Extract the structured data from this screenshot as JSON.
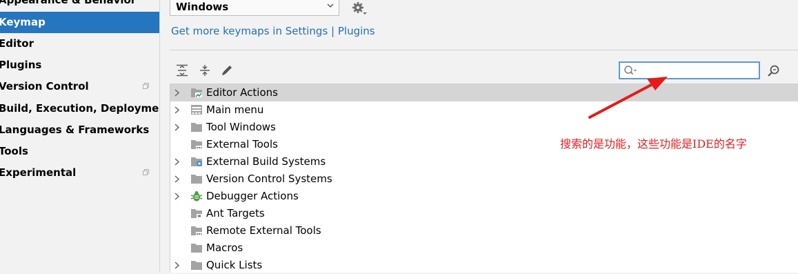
{
  "sidebar": {
    "items": [
      {
        "label": "Appearance & Behavior",
        "selected": false,
        "has_copy_icon": false
      },
      {
        "label": "Keymap",
        "selected": true,
        "has_copy_icon": false
      },
      {
        "label": "Editor",
        "selected": false,
        "has_copy_icon": false
      },
      {
        "label": "Plugins",
        "selected": false,
        "has_copy_icon": false
      },
      {
        "label": "Version Control",
        "selected": false,
        "has_copy_icon": true
      },
      {
        "label": "Build, Execution, Deployment",
        "selected": false,
        "has_copy_icon": false
      },
      {
        "label": "Languages & Frameworks",
        "selected": false,
        "has_copy_icon": false
      },
      {
        "label": "Tools",
        "selected": false,
        "has_copy_icon": false
      },
      {
        "label": "Experimental",
        "selected": false,
        "has_copy_icon": true
      }
    ]
  },
  "keymap": {
    "selected_value": "Windows",
    "link_text_1": "Get more keymaps in Settings",
    "link_separator": " | ",
    "link_text_2": "Plugins"
  },
  "search": {
    "value": "",
    "placeholder": ""
  },
  "tree": {
    "rows": [
      {
        "label": "Editor Actions",
        "expandable": true,
        "selected": true,
        "icon": "editor-actions-folder-icon"
      },
      {
        "label": "Main menu",
        "expandable": true,
        "selected": false,
        "icon": "main-menu-icon"
      },
      {
        "label": "Tool Windows",
        "expandable": true,
        "selected": false,
        "icon": "folder-icon"
      },
      {
        "label": "External Tools",
        "expandable": false,
        "selected": false,
        "icon": "folder-tools-icon"
      },
      {
        "label": "External Build Systems",
        "expandable": true,
        "selected": false,
        "icon": "folder-gear-icon"
      },
      {
        "label": "Version Control Systems",
        "expandable": true,
        "selected": false,
        "icon": "folder-icon"
      },
      {
        "label": "Debugger Actions",
        "expandable": true,
        "selected": false,
        "icon": "bug-icon"
      },
      {
        "label": "Ant Targets",
        "expandable": false,
        "selected": false,
        "icon": "folder-ant-icon"
      },
      {
        "label": "Remote External Tools",
        "expandable": false,
        "selected": false,
        "icon": "folder-tools-icon"
      },
      {
        "label": "Macros",
        "expandable": false,
        "selected": false,
        "icon": "folder-icon"
      },
      {
        "label": "Quick Lists",
        "expandable": true,
        "selected": false,
        "icon": "folder-icon"
      }
    ]
  },
  "annotation": {
    "text": "搜索的是功能，这些功能是IDE的名字"
  },
  "colors": {
    "accent": "#2675bf",
    "link": "#2470b3",
    "annotation": "#e02020",
    "selected_row": "#d5d5d5"
  }
}
